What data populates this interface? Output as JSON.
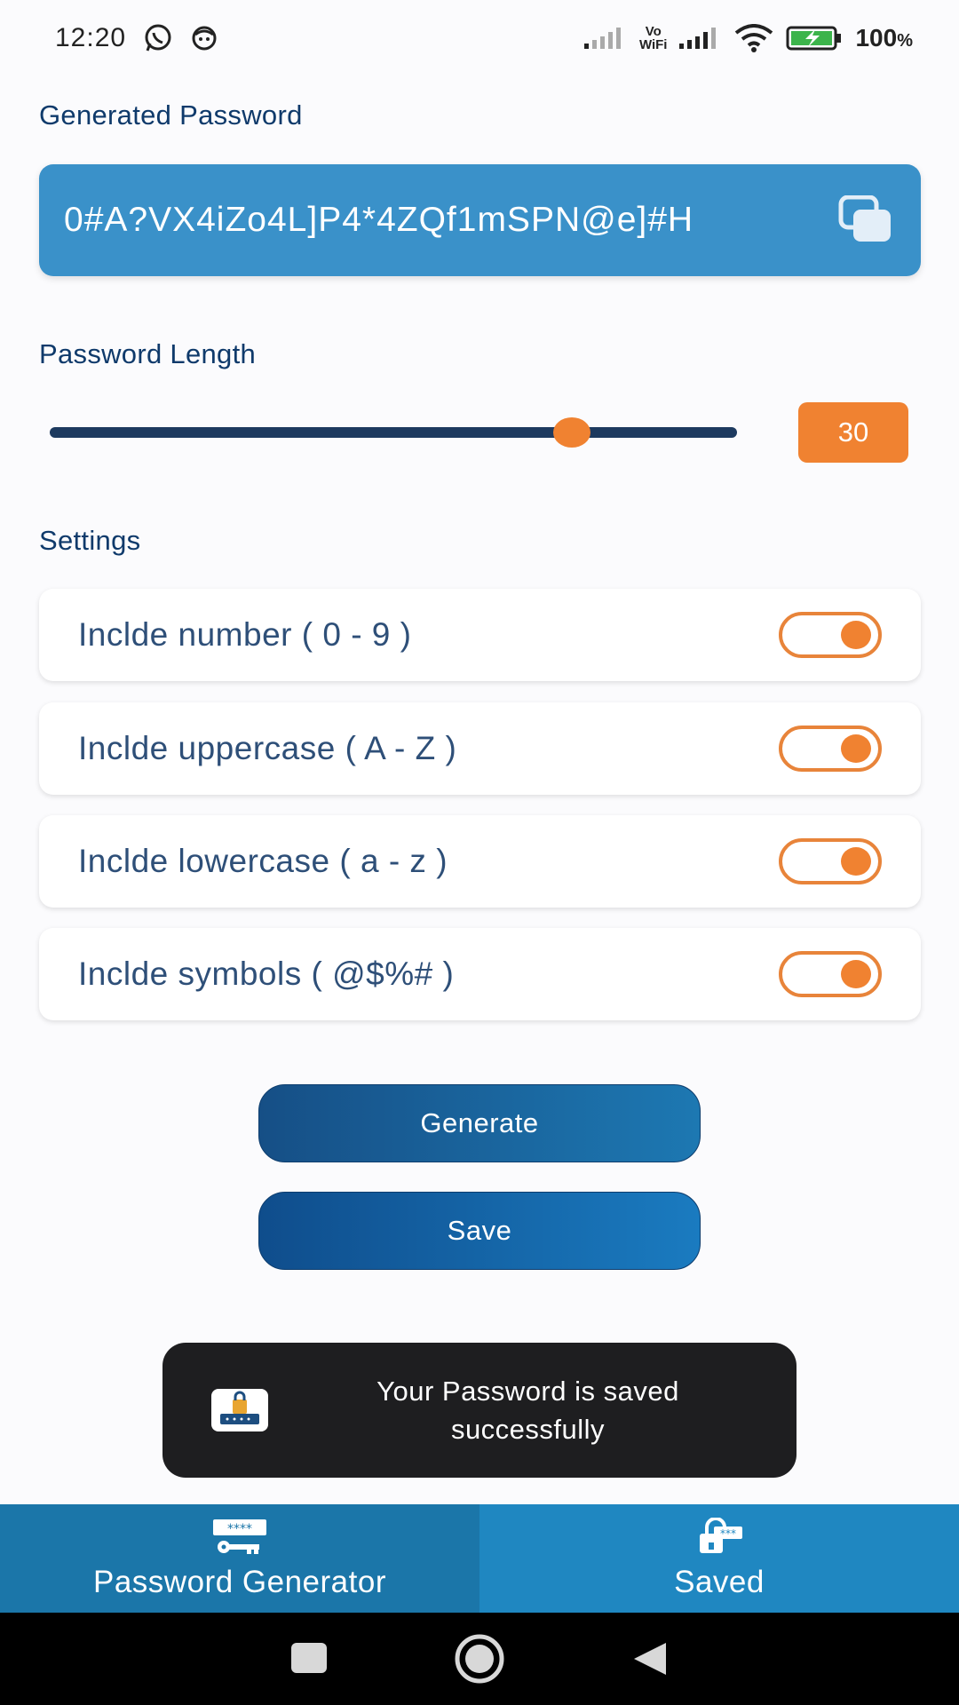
{
  "status_bar": {
    "time": "12:20",
    "battery": "100",
    "battery_unit": "%",
    "vo": "Vo",
    "wifi_label": "WiFi"
  },
  "generated_password": {
    "label": "Generated Password",
    "value": "0#A?VX4iZo4L]P4*4ZQf1mSPN@e]#H"
  },
  "password_length": {
    "label": "Password Length",
    "value": "30",
    "slider_fraction": 0.76
  },
  "settings": {
    "label": "Settings",
    "items": [
      {
        "label": "Inclde number ( 0 - 9 )",
        "enabled": true
      },
      {
        "label": "Inclde uppercase ( A - Z )",
        "enabled": true
      },
      {
        "label": "Inclde lowercase ( a - z )",
        "enabled": true
      },
      {
        "label": "Inclde symbols ( @$%# )",
        "enabled": true
      }
    ]
  },
  "buttons": {
    "generate": "Generate",
    "save": "Save"
  },
  "toast": {
    "line1": "Your Password is saved",
    "line2": "successfully"
  },
  "bottom_nav": {
    "items": [
      {
        "label": "Password Generator",
        "icon": "password-key-icon",
        "active": true
      },
      {
        "label": "Saved",
        "icon": "lock-password-icon",
        "active": false
      }
    ]
  },
  "colors": {
    "accent": "#f08231",
    "primary": "#3a91c9",
    "nav": "#1f87c1",
    "text": "#0f3a6b"
  }
}
